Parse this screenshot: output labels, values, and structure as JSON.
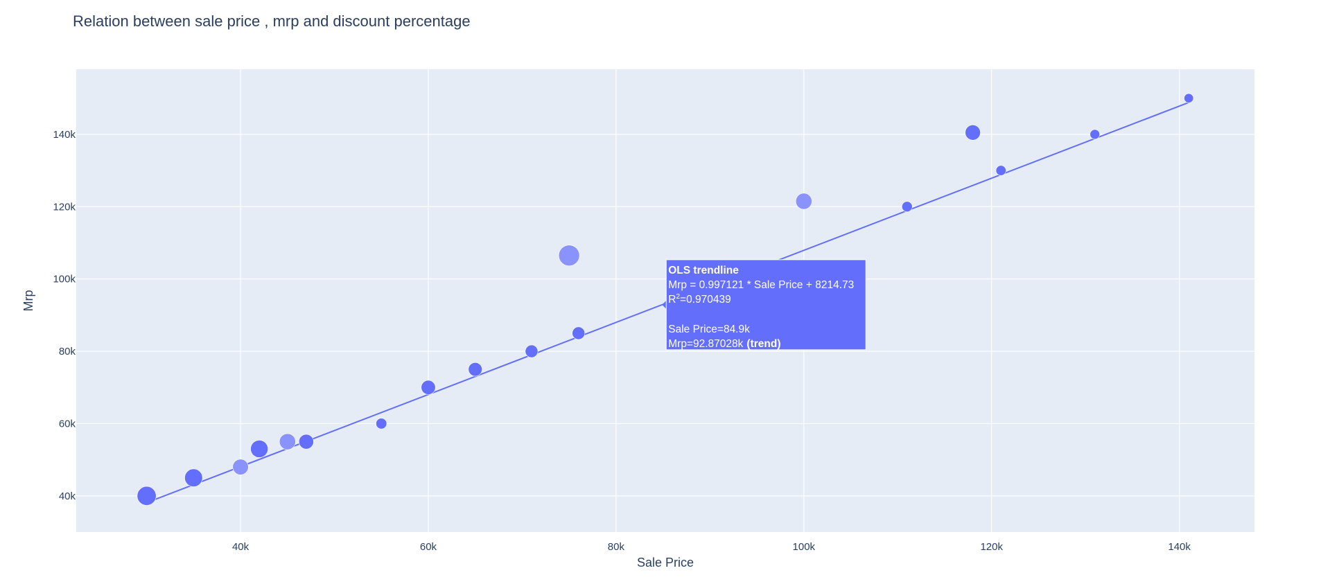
{
  "chart_data": {
    "type": "scatter",
    "title": "Relation between sale price , mrp and discount percentage",
    "xlabel": "Sale Price",
    "ylabel": "Mrp",
    "xlim": [
      22500,
      148000
    ],
    "ylim": [
      30000,
      158000
    ],
    "x_ticks": [
      40000,
      60000,
      80000,
      100000,
      120000,
      140000
    ],
    "x_tick_labels": [
      "40k",
      "60k",
      "80k",
      "100k",
      "120k",
      "140k"
    ],
    "y_ticks": [
      40000,
      60000,
      80000,
      100000,
      120000,
      140000
    ],
    "y_tick_labels": [
      "40k",
      "60k",
      "80k",
      "100k",
      "120k",
      "140k"
    ],
    "grid": true,
    "plot_background": "#e5ecf6",
    "marker_color": "#636efa",
    "trendline_color": "#636efa",
    "points": [
      {
        "x": 30000,
        "y": 40000,
        "discount": 25,
        "shade": "#636efa"
      },
      {
        "x": 35000,
        "y": 45000,
        "discount": 22,
        "shade": "#636efa"
      },
      {
        "x": 40000,
        "y": 48000,
        "discount": 17,
        "shade": "#8a92fb"
      },
      {
        "x": 42000,
        "y": 53000,
        "discount": 21,
        "shade": "#636efa"
      },
      {
        "x": 45000,
        "y": 55000,
        "discount": 18,
        "shade": "#8a92fb"
      },
      {
        "x": 47000,
        "y": 55000,
        "discount": 15,
        "shade": "#636efa"
      },
      {
        "x": 55000,
        "y": 60000,
        "discount": 8,
        "shade": "#636efa"
      },
      {
        "x": 60000,
        "y": 70000,
        "discount": 14,
        "shade": "#636efa"
      },
      {
        "x": 65000,
        "y": 75000,
        "discount": 13,
        "shade": "#636efa"
      },
      {
        "x": 71000,
        "y": 80000,
        "discount": 11,
        "shade": "#636efa"
      },
      {
        "x": 75000,
        "y": 106500,
        "discount": 30,
        "shade": "#8a92fb"
      },
      {
        "x": 76000,
        "y": 85000,
        "discount": 11,
        "shade": "#636efa"
      },
      {
        "x": 100000,
        "y": 121500,
        "discount": 18,
        "shade": "#8a92fb"
      },
      {
        "x": 111000,
        "y": 120000,
        "discount": 7.5,
        "shade": "#636efa"
      },
      {
        "x": 118000,
        "y": 140500,
        "discount": 16,
        "shade": "#636efa"
      },
      {
        "x": 121000,
        "y": 130000,
        "discount": 7,
        "shade": "#636efa"
      },
      {
        "x": 131000,
        "y": 140000,
        "discount": 6.5,
        "shade": "#636efa"
      },
      {
        "x": 141000,
        "y": 150000,
        "discount": 6,
        "shade": "#636efa"
      }
    ],
    "trendline": {
      "slope": 0.997121,
      "intercept": 8214.73,
      "x_range": [
        30000,
        141000
      ]
    },
    "hover": {
      "title": "OLS trendline",
      "equation": "Mrp = 0.997121 * Sale Price + 8214.73",
      "r2_prefix": "R",
      "r2_sup": "2",
      "r2_value": "=0.970439",
      "x_line": "Sale Price=84.9k",
      "y_line_value": "Mrp=92.87028k",
      "y_line_tag": "(trend)",
      "anchor_x": 84900,
      "anchor_y": 92870.28
    }
  }
}
